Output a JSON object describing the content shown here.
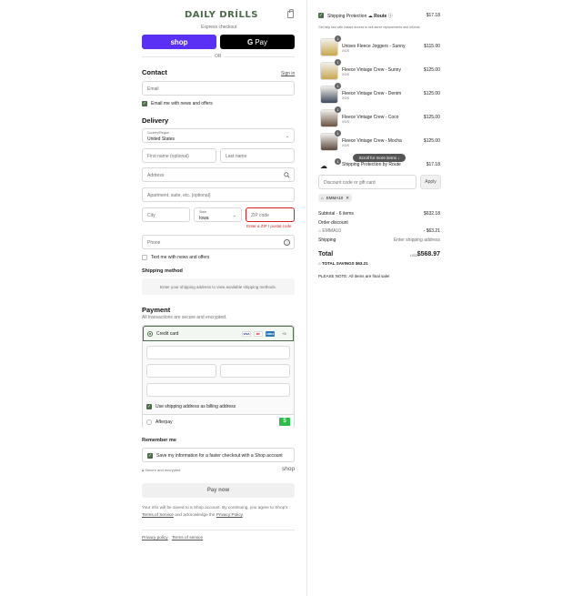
{
  "header": {
    "logo": "DAILY DRÍLLS"
  },
  "express": {
    "title": "Express checkout",
    "shop_label": "shop",
    "gpay_g": "G",
    "gpay_label": "Pay",
    "or_label": "OR"
  },
  "contact": {
    "title": "Contact",
    "sign_in": "Sign in",
    "email_placeholder": "Email",
    "news_label": "Email me with news and offers"
  },
  "delivery": {
    "title": "Delivery",
    "country_label": "Country/Region",
    "country_value": "United States",
    "first_name": "First name (optional)",
    "last_name": "Last name",
    "address": "Address",
    "apartment": "Apartment, suite, etc. (optional)",
    "city": "City",
    "state_label": "State",
    "state_value": "Iowa",
    "zip": "ZIP code",
    "zip_error": "Enter a ZIP / postal code",
    "phone": "Phone",
    "text_label": "Text me with news and offers"
  },
  "shipping_method": {
    "title": "Shipping method",
    "info": "Enter your shipping address to view available shipping methods."
  },
  "payment": {
    "title": "Payment",
    "subtitle": "All transactions are secure and encrypted.",
    "credit_card": "Credit card",
    "badges": [
      "VISA",
      "MC",
      "AMEX"
    ],
    "more": "+5",
    "billing_label": "Use shipping address as billing address",
    "afterpay": "Afterpay"
  },
  "remember": {
    "title": "Remember me",
    "save_label": "Save my information for a faster checkout with a Shop account",
    "secure": "Secure and encrypted",
    "shop_brand": "shop"
  },
  "pay_now": "Pay now",
  "legal": {
    "text1": "Your info will be saved to a Shop account. By continuing, you agree to Shop's",
    "tos": "Terms of Service",
    "text2": "and acknowledge the",
    "privacy": "Privacy Policy",
    "end": "."
  },
  "footer": {
    "privacy": "Privacy policy",
    "terms": "Terms of service"
  },
  "summary": {
    "protection_label": "Shipping Protection",
    "route": "Route",
    "protection_price": "$17.18",
    "protection_note": "Get help fast with instant access to self-serve replacements and refunds",
    "items": [
      {
        "name": "Unisex Fleece Joggers - Sunny",
        "variant": "XS/S",
        "qty": "1",
        "price": "$115.00",
        "color": "#c9a84a"
      },
      {
        "name": "Fleece Vintage Crew - Sunny",
        "variant": "XS/S",
        "qty": "1",
        "price": "$125.00",
        "color": "#c7a74f"
      },
      {
        "name": "Fleece Vintage Crew - Denim",
        "variant": "XS/S",
        "qty": "1",
        "price": "$125.00",
        "color": "#3f4a5e"
      },
      {
        "name": "Fleece Vintage Crew - Coco",
        "variant": "XS/S",
        "qty": "1",
        "price": "$125.00",
        "color": "#6b5241"
      },
      {
        "name": "Fleece Vintage Crew - Mocha",
        "variant": "XS/S",
        "qty": "1",
        "price": "$125.00",
        "color": "#5b4a3f"
      }
    ],
    "scroll_hint": "Scroll for more items",
    "last_item": {
      "name": "Shipping Protection by Route",
      "qty": "1",
      "price": "$17.18"
    },
    "discount_placeholder": "Discount code or gift card",
    "apply": "Apply",
    "code": "EMMA10",
    "subtotal_label": "Subtotal · 6 items",
    "subtotal": "$632.18",
    "order_discount": "Order discount",
    "discount_code": "EMMA10",
    "discount_amount": "- $63.21",
    "shipping_label": "Shipping",
    "shipping_value": "Enter shipping address",
    "total_label": "Total",
    "currency": "USD",
    "total": "$568.97",
    "savings_label": "TOTAL SAVINGS",
    "savings": "$63.21",
    "note": "PLEASE NOTE: All items are final sale!"
  }
}
